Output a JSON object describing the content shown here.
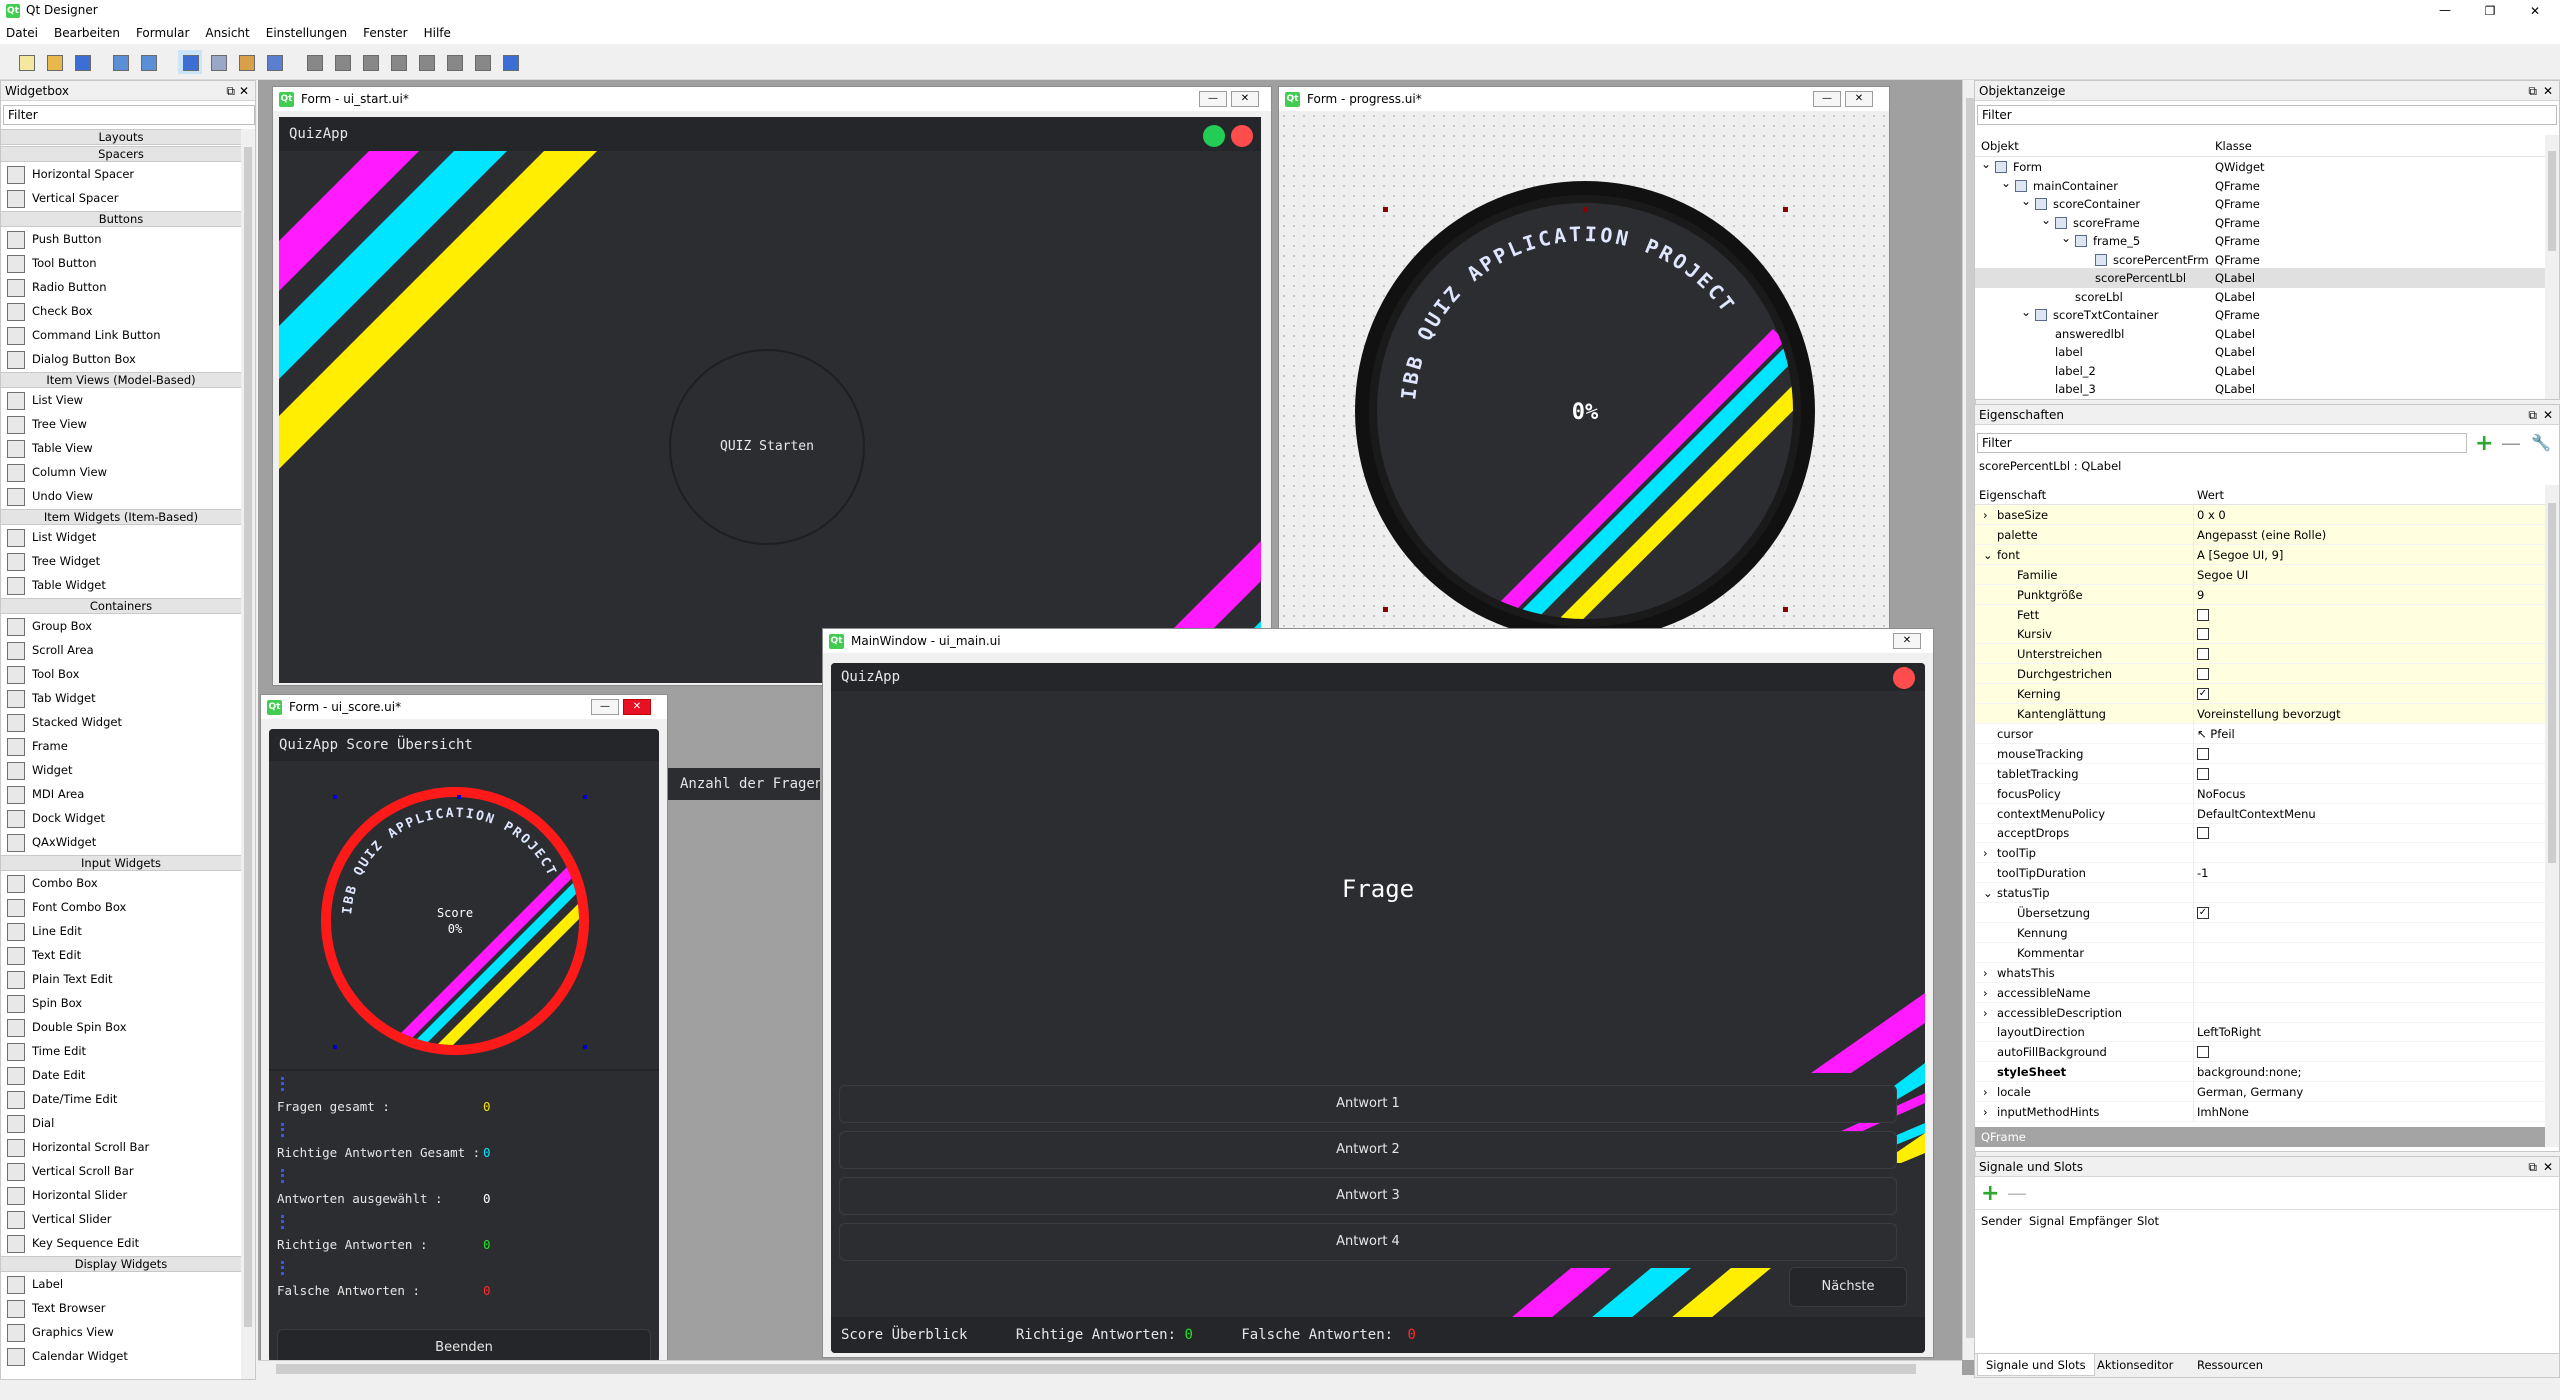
{
  "window": {
    "title": "Qt Designer"
  },
  "menu": [
    "Datei",
    "Bearbeiten",
    "Formular",
    "Ansicht",
    "Einstellungen",
    "Fenster",
    "Hilfe"
  ],
  "toolbar_icons": [
    "new-file-icon",
    "open-folder-icon",
    "save-icon",
    "copy-icon",
    "paste-icon",
    "edit-widgets-icon",
    "edit-signals-icon",
    "edit-buddies-icon",
    "edit-tab-order-icon",
    "layout-horizontal-icon",
    "layout-vertical-icon",
    "layout-h-splitter-icon",
    "layout-v-splitter-icon",
    "layout-grid-icon",
    "layout-form-icon",
    "break-layout-icon",
    "adjust-size-icon"
  ],
  "widgetbox": {
    "title": "Widgetbox",
    "filter_placeholder": "Filter",
    "sections": [
      {
        "label": "Layouts",
        "items": []
      },
      {
        "label": "Spacers",
        "items": [
          "Horizontal Spacer",
          "Vertical Spacer"
        ]
      },
      {
        "label": "Buttons",
        "items": [
          "Push Button",
          "Tool Button",
          "Radio Button",
          "Check Box",
          "Command Link Button",
          "Dialog Button Box"
        ]
      },
      {
        "label": "Item Views (Model-Based)",
        "items": [
          "List View",
          "Tree View",
          "Table View",
          "Column View",
          "Undo View"
        ]
      },
      {
        "label": "Item Widgets (Item-Based)",
        "items": [
          "List Widget",
          "Tree Widget",
          "Table Widget"
        ]
      },
      {
        "label": "Containers",
        "items": [
          "Group Box",
          "Scroll Area",
          "Tool Box",
          "Tab Widget",
          "Stacked Widget",
          "Frame",
          "Widget",
          "MDI Area",
          "Dock Widget",
          "QAxWidget"
        ]
      },
      {
        "label": "Input Widgets",
        "items": [
          "Combo Box",
          "Font Combo Box",
          "Line Edit",
          "Text Edit",
          "Plain Text Edit",
          "Spin Box",
          "Double Spin Box",
          "Time Edit",
          "Date Edit",
          "Date/Time Edit",
          "Dial",
          "Horizontal Scroll Bar",
          "Vertical Scroll Bar",
          "Horizontal Slider",
          "Vertical Slider",
          "Key Sequence Edit"
        ]
      },
      {
        "label": "Display Widgets",
        "items": [
          "Label",
          "Text Browser",
          "Graphics View",
          "Calendar Widget"
        ]
      }
    ]
  },
  "win_start": {
    "title": "Form - ui_start.ui*",
    "app_title": "QuizApp",
    "button": "QUIZ Starten"
  },
  "win_progress": {
    "title": "Form - progress.ui*",
    "percent": "0%",
    "ring_text": "IBB QUIZ APPLICATION PROJECT"
  },
  "win_score": {
    "title": "Form - ui_score.ui*",
    "header": "QuizApp Score Übersicht",
    "score_label": "Score",
    "score_value": "0%",
    "ring_text": "IBB QUIZ APPLICATION PROJECT",
    "rows": [
      {
        "label": "Fragen gesamt :",
        "value": "0",
        "color": "#f5e100"
      },
      {
        "label": "Richtige Antworten Gesamt :",
        "value": "0",
        "color": "#00e5ff"
      },
      {
        "label": "Antworten ausgewählt :",
        "value": "0",
        "color": "#ffffff"
      },
      {
        "label": "Richtige Antworten :",
        "value": "0",
        "color": "#22e022"
      },
      {
        "label": "Falsche Antworten :",
        "value": "0",
        "color": "#ff2a2a"
      }
    ],
    "button": "Beenden"
  },
  "partial_label": "Anzahl der Fragen",
  "win_main": {
    "title": "MainWindow - ui_main.ui",
    "app_title": "QuizApp",
    "question": "Frage",
    "answers": [
      "Antwort 1",
      "Antwort 2",
      "Antwort 3",
      "Antwort 4"
    ],
    "next": "Nächste",
    "footer": {
      "overview": "Score Überblick",
      "correct_label": "Richtige Antworten:",
      "correct_value": "0",
      "wrong_label": "Falsche Antworten:",
      "wrong_value": "0"
    }
  },
  "objects": {
    "title": "Objektanzeige",
    "filter_placeholder": "Filter",
    "headers": [
      "Objekt",
      "Klasse"
    ],
    "rows": [
      {
        "name": "Form",
        "cls": "QWidget",
        "lvl": 0
      },
      {
        "name": "mainContainer",
        "cls": "QFrame",
        "lvl": 1
      },
      {
        "name": "scoreContainer",
        "cls": "QFrame",
        "lvl": 2
      },
      {
        "name": "scoreFrame",
        "cls": "QFrame",
        "lvl": 3
      },
      {
        "name": "frame_5",
        "cls": "QFrame",
        "lvl": 4
      },
      {
        "name": "scorePercentFrm",
        "cls": "QFrame",
        "lvl": 5
      },
      {
        "name": "scorePercentLbl",
        "cls": "QLabel",
        "lvl": 5
      },
      {
        "name": "scoreLbl",
        "cls": "QLabel",
        "lvl": 4
      },
      {
        "name": "scoreTxtContainer",
        "cls": "QFrame",
        "lvl": 2
      },
      {
        "name": "answeredlbl",
        "cls": "QLabel",
        "lvl": 3
      },
      {
        "name": "label",
        "cls": "QLabel",
        "lvl": 3
      },
      {
        "name": "label_2",
        "cls": "QLabel",
        "lvl": 3
      },
      {
        "name": "label_3",
        "cls": "QLabel",
        "lvl": 3
      }
    ]
  },
  "properties": {
    "title": "Eigenschaften",
    "filter_placeholder": "Filter",
    "context": "scorePercentLbl : QLabel",
    "headers": [
      "Eigenschaft",
      "Wert"
    ],
    "rows": [
      {
        "n": "baseSize",
        "v": "0 x 0",
        "y": true,
        "x": "›"
      },
      {
        "n": "palette",
        "v": "Angepasst (eine Rolle)",
        "y": true
      },
      {
        "n": "font",
        "v": "A  [Segoe UI, 9]",
        "y": true,
        "x": "⌄"
      },
      {
        "n": "Familie",
        "v": "Segoe UI",
        "y": true,
        "i": 1
      },
      {
        "n": "Punktgröße",
        "v": "9",
        "y": true,
        "i": 1
      },
      {
        "n": "Fett",
        "v": "",
        "cb": "off",
        "y": true,
        "i": 1
      },
      {
        "n": "Kursiv",
        "v": "",
        "cb": "off",
        "y": true,
        "i": 1
      },
      {
        "n": "Unterstreichen",
        "v": "",
        "cb": "off",
        "y": true,
        "i": 1
      },
      {
        "n": "Durchgestrichen",
        "v": "",
        "cb": "off",
        "y": true,
        "i": 1
      },
      {
        "n": "Kerning",
        "v": "",
        "cb": "on",
        "y": true,
        "i": 1
      },
      {
        "n": "Kantenglättung",
        "v": "Voreinstellung bevorzugt",
        "y": true,
        "i": 1
      },
      {
        "n": "cursor",
        "v": "↖  Pfeil",
        "y": false
      },
      {
        "n": "mouseTracking",
        "v": "",
        "cb": "off",
        "y": false
      },
      {
        "n": "tabletTracking",
        "v": "",
        "cb": "off",
        "y": false
      },
      {
        "n": "focusPolicy",
        "v": "NoFocus",
        "y": false
      },
      {
        "n": "contextMenuPolicy",
        "v": "DefaultContextMenu",
        "y": false
      },
      {
        "n": "acceptDrops",
        "v": "",
        "cb": "off",
        "y": false
      },
      {
        "n": "toolTip",
        "v": "",
        "y": false,
        "x": "›"
      },
      {
        "n": "toolTipDuration",
        "v": "-1",
        "y": false
      },
      {
        "n": "statusTip",
        "v": "",
        "y": false,
        "x": "⌄"
      },
      {
        "n": "Übersetzung",
        "v": "",
        "cb": "on",
        "y": false,
        "i": 1
      },
      {
        "n": "Kennung",
        "v": "",
        "y": false,
        "i": 1
      },
      {
        "n": "Kommentar",
        "v": "",
        "y": false,
        "i": 1
      },
      {
        "n": "whatsThis",
        "v": "",
        "y": false,
        "x": "›"
      },
      {
        "n": "accessibleName",
        "v": "",
        "y": false,
        "x": "›"
      },
      {
        "n": "accessibleDescription",
        "v": "",
        "y": false,
        "x": "›"
      },
      {
        "n": "layoutDirection",
        "v": "LeftToRight",
        "y": false
      },
      {
        "n": "autoFillBackground",
        "v": "",
        "cb": "off",
        "y": false
      },
      {
        "n": "styleSheet",
        "v": "background:none;",
        "y": false,
        "b": true
      },
      {
        "n": "locale",
        "v": "German, Germany",
        "y": false,
        "x": "›"
      },
      {
        "n": "inputMethodHints",
        "v": "ImhNone",
        "y": false,
        "x": "›"
      }
    ],
    "section_footer": "QFrame"
  },
  "signals": {
    "title": "Signale und Slots",
    "headers": [
      "Sender",
      "Signal",
      "Empfänger",
      "Slot"
    ],
    "tabs": [
      "Signale und Slots",
      "Aktionseditor",
      "Ressourcen"
    ]
  },
  "colors": {
    "magenta": "#ff1aff",
    "cyan": "#00e5ff",
    "yellow": "#ffee00",
    "dark": "#2c2d31",
    "darker": "#25262a",
    "red": "#ff1a1a",
    "green": "#22cc55"
  }
}
